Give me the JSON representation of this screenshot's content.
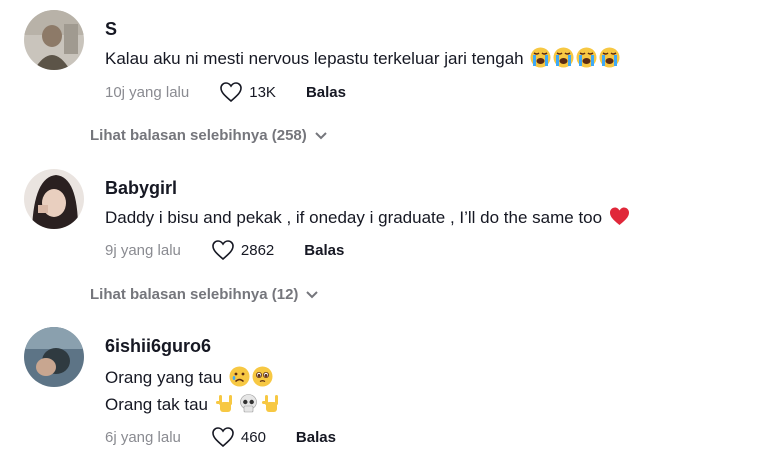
{
  "comments": [
    {
      "username": "S",
      "text": "Kalau aku ni mesti nervous lepastu terkeluar jari tengah",
      "emojis": [
        "loudly-crying-face",
        "loudly-crying-face",
        "loudly-crying-face",
        "loudly-crying-face"
      ],
      "time": "10j yang lalu",
      "likes": "13K",
      "reply_label": "Balas",
      "more_replies": "Lihat balasan selebihnya (258)"
    },
    {
      "username": "Babygirl",
      "text": "Daddy i bisu and pekak , if oneday i graduate , I’ll do the same too",
      "emojis": [
        "red-heart"
      ],
      "time": "9j yang lalu",
      "likes": "2862",
      "reply_label": "Balas",
      "more_replies": "Lihat balasan selebihnya (12)"
    },
    {
      "username": "6ishii6guro6",
      "lines": [
        {
          "text": "Orang yang tau",
          "emojis": [
            "sad-face",
            "pleading-face"
          ]
        },
        {
          "text": "Orang tak tau",
          "emojis": [
            "rock-on-hand",
            "skull",
            "rock-on-hand"
          ]
        }
      ],
      "time": "6j yang lalu",
      "likes": "460",
      "reply_label": "Balas"
    }
  ],
  "colors": {
    "primary_text": "#161823",
    "secondary_text": "#8a8b91",
    "heart": "#e0283a",
    "emoji_yellow": "#f7c843"
  }
}
